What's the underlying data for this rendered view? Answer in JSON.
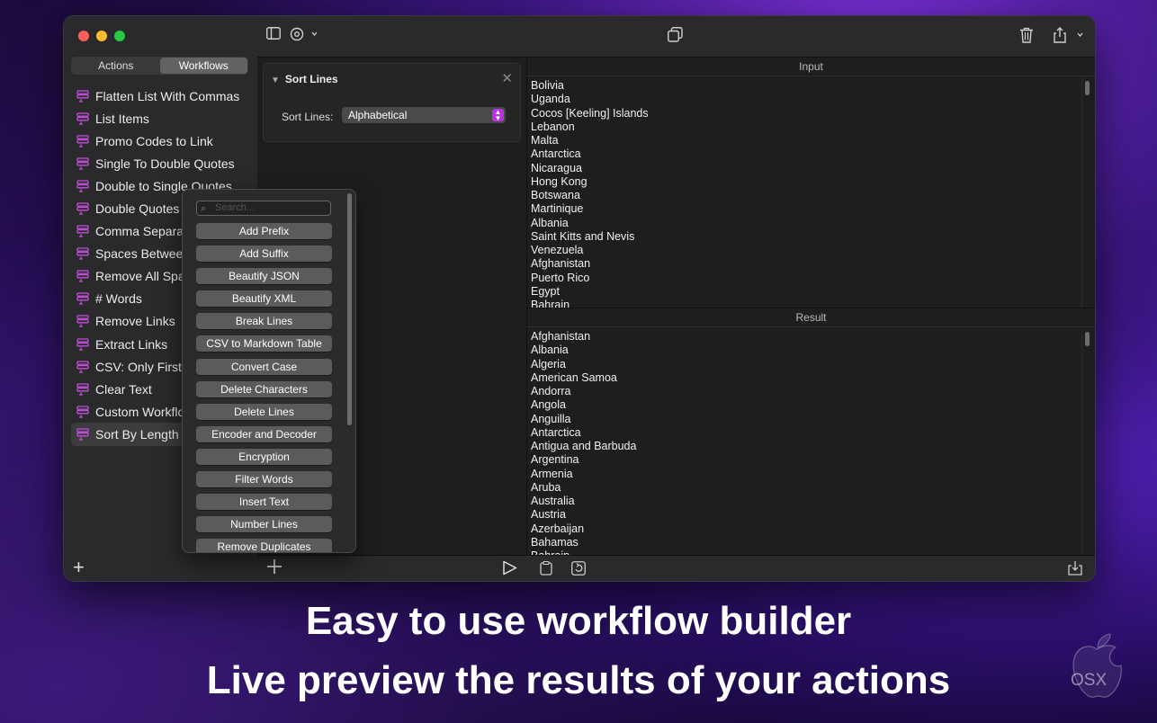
{
  "sidebar": {
    "segments": [
      "Actions",
      "Workflows"
    ],
    "active_segment": "Workflows",
    "workflows": [
      "Flatten List With Commas",
      "List Items",
      "Promo Codes to Link",
      "Single To Double Quotes",
      "Double to Single Quotes",
      "Double Quotes",
      "Comma Separat",
      "Spaces Betweer",
      "Remove All Spa",
      "# Words",
      "Remove Links",
      "Extract Links",
      "CSV: Only First",
      "Clear Text",
      "Custom Workflo",
      "Sort By Length"
    ],
    "selected_workflow": "Sort By Length",
    "add_label": "+"
  },
  "action_card": {
    "title": "Sort Lines",
    "close_label": "✕",
    "field_label": "Sort Lines:",
    "field_value": "Alphabetical"
  },
  "popover": {
    "search_placeholder": "Search...",
    "actions": [
      "Add Prefix",
      "Add Suffix",
      "Beautify JSON",
      "Beautify XML",
      "Break Lines",
      "CSV to Markdown Table",
      "Convert Case",
      "Delete Characters",
      "Delete Lines",
      "Encoder and Decoder",
      "Encryption",
      "Filter Words",
      "Insert Text",
      "Number Lines",
      "Remove Duplicates"
    ]
  },
  "input": {
    "header": "Input",
    "lines": [
      "Bolivia",
      "Uganda",
      "Cocos [Keeling] Islands",
      "Lebanon",
      "Malta",
      "Antarctica",
      "Nicaragua",
      "Hong Kong",
      "Botswana",
      "Martinique",
      "Albania",
      "Saint Kitts and Nevis",
      "Venezuela",
      "Afghanistan",
      "Puerto Rico",
      "Egypt",
      "Bahrain"
    ]
  },
  "result": {
    "header": "Result",
    "lines": [
      "Afghanistan",
      "Albania",
      "Algeria",
      "American Samoa",
      "Andorra",
      "Angola",
      "Anguilla",
      "Antarctica",
      "Antigua and Barbuda",
      "Argentina",
      "Armenia",
      "Aruba",
      "Australia",
      "Austria",
      "Azerbaijan",
      "Bahamas",
      "Bahrain"
    ]
  },
  "captions": {
    "line1": "Easy to use workflow builder",
    "line2": "Live preview the results of your actions"
  },
  "logo_text": "OSX",
  "colors": {
    "accent": "#b832e0",
    "workflow_icon": "#c050d8"
  }
}
